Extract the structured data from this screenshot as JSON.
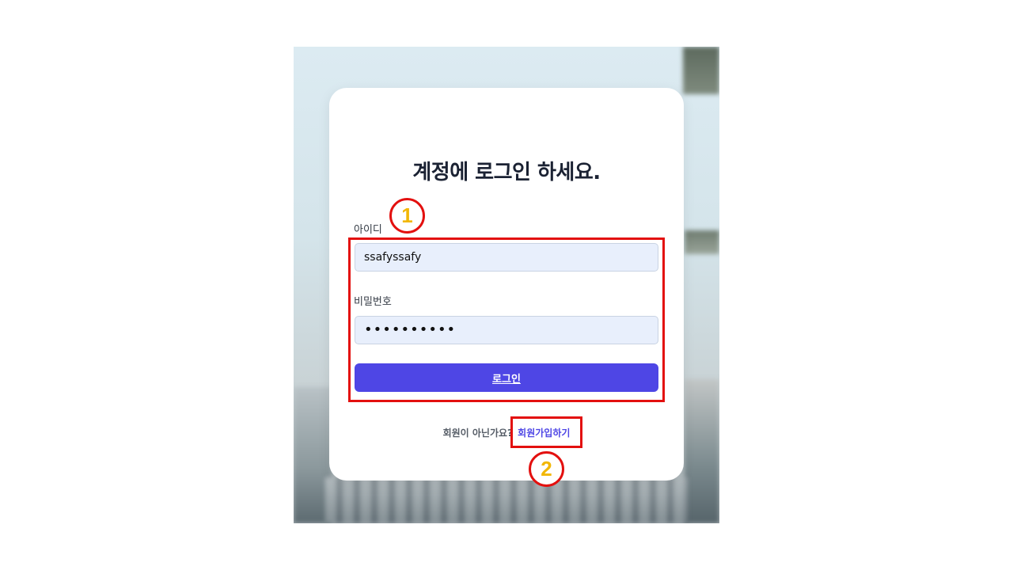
{
  "login": {
    "title": "계정에 로그인 하세요.",
    "id_label": "아이디",
    "id_value": "ssafyssafy",
    "password_label": "비밀번호",
    "password_value": "••••••••••",
    "login_button": "로그인"
  },
  "signup": {
    "prompt": "회원이 아닌가요?",
    "link": "회원가입하기"
  },
  "annotations": {
    "marker_1": "1",
    "marker_2": "2",
    "box_color": "#e3100f",
    "number_color": "#f2b705"
  },
  "colors": {
    "accent": "#4e46e5",
    "input_bg": "#e8effc"
  }
}
